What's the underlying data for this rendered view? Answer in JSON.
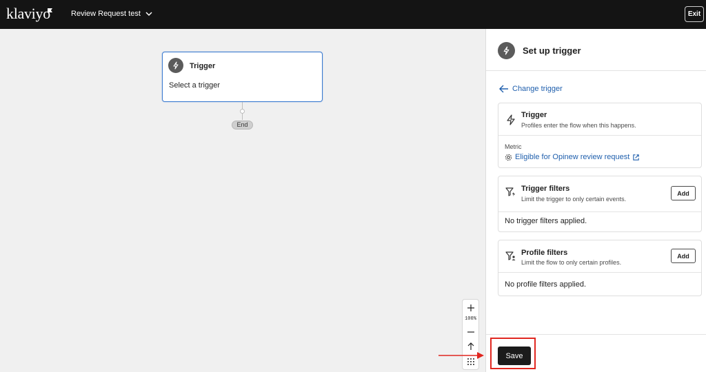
{
  "app": {
    "logo_text": "klaviyo"
  },
  "header": {
    "flow_name": "Review Request test",
    "exit_label": "Exit"
  },
  "canvas": {
    "trigger_node": {
      "title": "Trigger",
      "subtitle": "Select a trigger"
    },
    "end_label": "End",
    "zoom": {
      "level": "100%"
    }
  },
  "panel": {
    "title": "Set up trigger",
    "change_trigger_label": "Change trigger",
    "trigger_card": {
      "title": "Trigger",
      "description": "Profiles enter the flow when this happens.",
      "metric_label": "Metric",
      "metric_value": "Eligible for Opinew review request"
    },
    "trigger_filters": {
      "title": "Trigger filters",
      "description": "Limit the trigger to only certain events.",
      "add_label": "Add",
      "empty_text": "No trigger filters applied."
    },
    "profile_filters": {
      "title": "Profile filters",
      "description": "Limit the flow to only certain profiles.",
      "add_label": "Add",
      "empty_text": "No profile filters applied."
    },
    "save_label": "Save"
  },
  "colors": {
    "link": "#1f5fad",
    "annotation": "#e0261f",
    "topbar": "#141414"
  }
}
